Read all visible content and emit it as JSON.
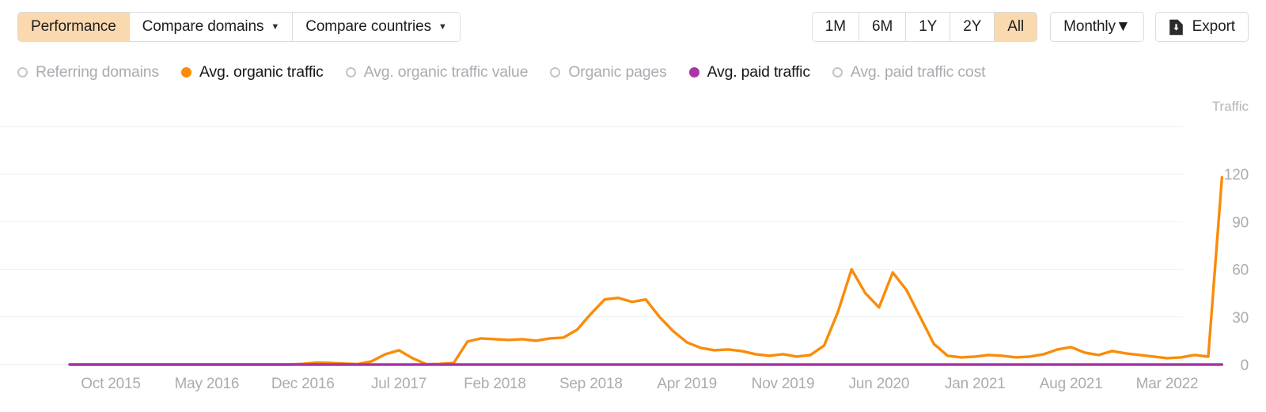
{
  "toolbar": {
    "view_tabs": [
      {
        "label": "Performance",
        "active": true,
        "caret": false
      },
      {
        "label": "Compare domains",
        "active": false,
        "caret": true
      },
      {
        "label": "Compare countries",
        "active": false,
        "caret": true
      }
    ],
    "ranges": [
      {
        "label": "1M",
        "active": false
      },
      {
        "label": "6M",
        "active": false
      },
      {
        "label": "1Y",
        "active": false
      },
      {
        "label": "2Y",
        "active": false
      },
      {
        "label": "All",
        "active": true
      }
    ],
    "granularity": {
      "label": "Monthly",
      "caret": "▼"
    },
    "export": {
      "label": "Export",
      "icon": "file-download-icon"
    },
    "caret_glyph": "▼",
    "accent_peach": "#FBD9AE",
    "border_color": "#D9DBDD"
  },
  "legend": {
    "items": [
      {
        "label": "Referring domains",
        "active": false,
        "color": "#C2C5C8"
      },
      {
        "label": "Avg. organic traffic",
        "active": true,
        "color": "#F98C09"
      },
      {
        "label": "Avg. organic traffic value",
        "active": false,
        "color": "#C2C5C8"
      },
      {
        "label": "Organic pages",
        "active": false,
        "color": "#C2C5C8"
      },
      {
        "label": "Avg. paid traffic",
        "active": true,
        "color": "#A935A9"
      },
      {
        "label": "Avg. paid traffic cost",
        "active": false,
        "color": "#C2C5C8"
      }
    ]
  },
  "chart_data": {
    "type": "line",
    "title": "",
    "xlabel": "",
    "ylabel": "Traffic",
    "ylim": [
      0,
      150
    ],
    "yticks": [
      120,
      90,
      60,
      30,
      0
    ],
    "gridlines": [
      150,
      120,
      90,
      60,
      30,
      0
    ],
    "grid": true,
    "legend_position": "top-left",
    "xticks": [
      "Oct 2015",
      "May 2016",
      "Dec 2016",
      "Jul 2017",
      "Feb 2018",
      "Sep 2018",
      "Apr 2019",
      "Nov 2019",
      "Jun 2020",
      "Jan 2021",
      "Aug 2021",
      "Mar 2022"
    ],
    "xtick_indices": [
      3,
      10,
      17,
      24,
      31,
      38,
      45,
      52,
      59,
      66,
      73,
      80
    ],
    "x_start": "Jul 2015",
    "x_end": "Mar 2022",
    "x_count": 81,
    "series": [
      {
        "name": "Avg. organic traffic",
        "color": "#F98C09",
        "values": [
          0,
          0,
          0,
          0,
          0,
          0,
          0,
          0,
          0,
          0,
          0,
          0,
          0,
          0,
          0,
          0,
          0,
          0.4,
          1.2,
          1.0,
          0.6,
          0.3,
          2.0,
          6.5,
          9.0,
          4.0,
          0.2,
          0.4,
          1.0,
          14.5,
          16.5,
          16.0,
          15.5,
          16.0,
          15.0,
          16.5,
          17.0,
          22.0,
          32.0,
          41.0,
          42.0,
          39.5,
          41.0,
          30.0,
          21.0,
          14.0,
          10.5,
          9.0,
          9.5,
          8.5,
          6.5,
          5.5,
          6.5,
          5.0,
          6.0,
          12.0,
          33.0,
          60.0,
          45.0,
          36.0,
          58.0,
          47.0,
          30.0,
          13.0,
          5.5,
          4.5,
          5.0,
          6.0,
          5.5,
          4.5,
          5.0,
          6.5,
          9.5,
          11.0,
          7.5,
          6.0,
          8.5,
          7.0,
          6.0,
          5.0,
          4.0,
          4.5,
          6.0,
          5.0,
          118.0
        ]
      },
      {
        "name": "Avg. paid traffic",
        "color": "#A935A9",
        "values": [
          0,
          0,
          0,
          0,
          0,
          0,
          0,
          0,
          0,
          0,
          0,
          0,
          0,
          0,
          0,
          0,
          0,
          0,
          0,
          0,
          0,
          0,
          0,
          0,
          0,
          0,
          0,
          0,
          0,
          0,
          0,
          0,
          0,
          0,
          0,
          0,
          0,
          0,
          0,
          0,
          0,
          0,
          0,
          0,
          0,
          0,
          0,
          0,
          0,
          0,
          0,
          0,
          0,
          0,
          0,
          0,
          0,
          0,
          0,
          0,
          0,
          0,
          0,
          0,
          0,
          0,
          0,
          0,
          0,
          0,
          0,
          0,
          0,
          0,
          0,
          0,
          0,
          0,
          0,
          0,
          0,
          0,
          0,
          0,
          0
        ]
      }
    ]
  }
}
